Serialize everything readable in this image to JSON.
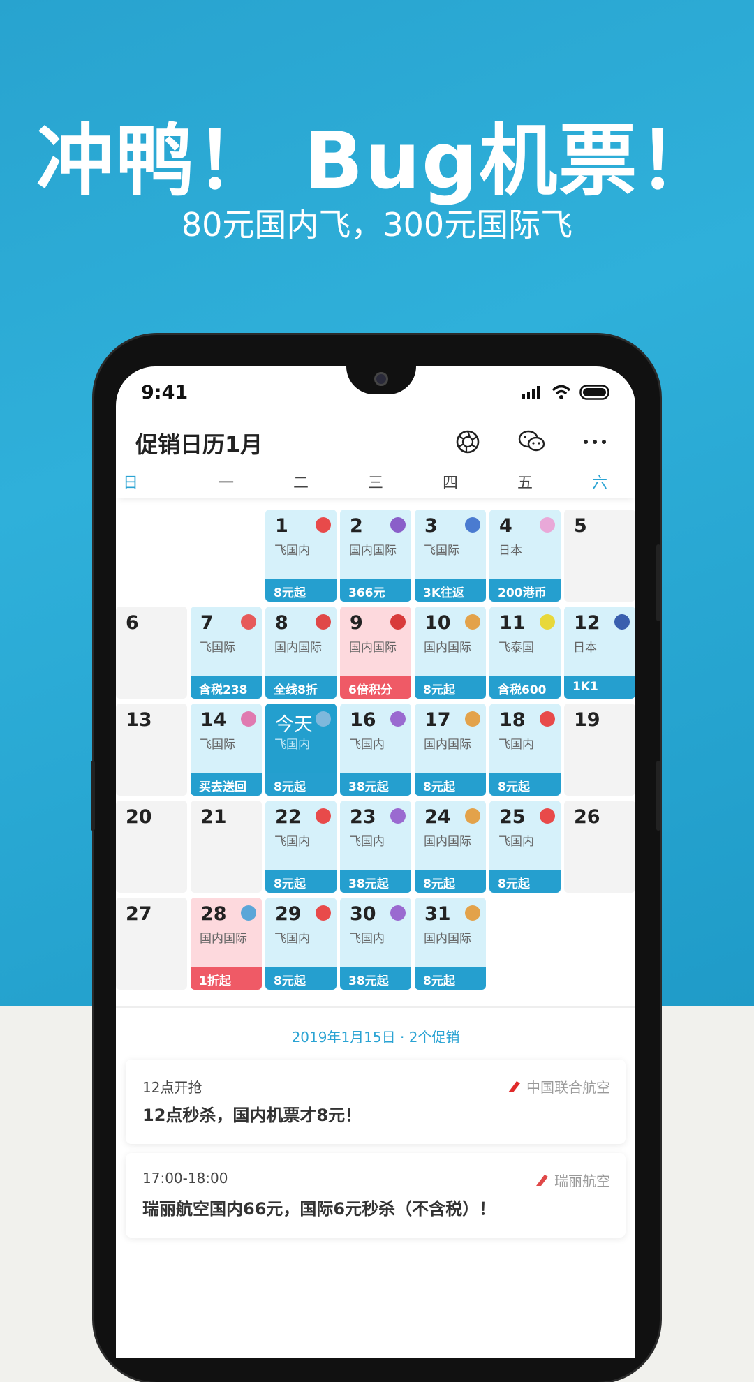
{
  "promo": {
    "headline": "冲鸭！ Bug机票！",
    "subline": "80元国内飞，300元国际飞"
  },
  "status": {
    "time": "9:41"
  },
  "header": {
    "title": "促销日历1月",
    "icons": [
      "shutter-icon",
      "wechat-icon",
      "more-icon"
    ]
  },
  "colors": {
    "accent": "#2aa3d3",
    "promo_bg": "#d6f1fa",
    "pink": "#ef5a66"
  },
  "weekdays": [
    "日",
    "一",
    "二",
    "三",
    "四",
    "五",
    "六"
  ],
  "leading_empty": 2,
  "days": [
    {
      "n": "1",
      "sub": "飞国内",
      "tag": "8元起",
      "type": "promo",
      "logo": "#e84a4a"
    },
    {
      "n": "2",
      "sub": "国内国际",
      "tag": "366元",
      "type": "promo",
      "logo": "#8a5fc9"
    },
    {
      "n": "3",
      "sub": "飞国际",
      "tag": "3K往返",
      "type": "promo",
      "logo": "#4a7bd0"
    },
    {
      "n": "4",
      "sub": "日本",
      "tag": "200港币",
      "type": "promo",
      "logo": "#e9a8d8"
    },
    {
      "n": "5",
      "type": "gray"
    },
    {
      "n": "6",
      "type": "gray"
    },
    {
      "n": "7",
      "sub": "飞国际",
      "tag": "含税238",
      "type": "promo",
      "logo": "#e65a5a"
    },
    {
      "n": "8",
      "sub": "国内国际",
      "tag": "全线8折",
      "type": "promo",
      "logo": "#e04848"
    },
    {
      "n": "9",
      "sub": "国内国际",
      "tag": "6倍积分",
      "type": "pink",
      "logo": "#d83a3a"
    },
    {
      "n": "10",
      "sub": "国内国际",
      "tag": "8元起",
      "type": "promo",
      "logo": "#e3a24a"
    },
    {
      "n": "11",
      "sub": "飞泰国",
      "tag": "含税600",
      "type": "promo",
      "logo": "#e8d83a"
    },
    {
      "n": "12",
      "sub": "日本",
      "tag": "1K1",
      "type": "promo",
      "logo": "#3a5fae"
    },
    {
      "n": "13",
      "type": "gray"
    },
    {
      "n": "14",
      "sub": "飞国际",
      "tag": "买去送回",
      "type": "promo",
      "logo": "#e07ab0"
    },
    {
      "n": "今天",
      "sub": "飞国内",
      "tag": "8元起",
      "type": "today",
      "logo": "#7fb8dc"
    },
    {
      "n": "16",
      "sub": "飞国内",
      "tag": "38元起",
      "type": "promo",
      "logo": "#9a6ad0"
    },
    {
      "n": "17",
      "sub": "国内国际",
      "tag": "8元起",
      "type": "promo",
      "logo": "#e3a24a"
    },
    {
      "n": "18",
      "sub": "飞国内",
      "tag": "8元起",
      "type": "promo",
      "logo": "#e84a4a"
    },
    {
      "n": "19",
      "type": "gray"
    },
    {
      "n": "20",
      "type": "gray"
    },
    {
      "n": "21",
      "type": "gray"
    },
    {
      "n": "22",
      "sub": "飞国内",
      "tag": "8元起",
      "type": "promo",
      "logo": "#e84a4a"
    },
    {
      "n": "23",
      "sub": "飞国内",
      "tag": "38元起",
      "type": "promo",
      "logo": "#9a6ad0"
    },
    {
      "n": "24",
      "sub": "国内国际",
      "tag": "8元起",
      "type": "promo",
      "logo": "#e3a24a"
    },
    {
      "n": "25",
      "sub": "飞国内",
      "tag": "8元起",
      "type": "promo",
      "logo": "#e84a4a"
    },
    {
      "n": "26",
      "type": "gray"
    },
    {
      "n": "27",
      "type": "gray"
    },
    {
      "n": "28",
      "sub": "国内国际",
      "tag": "1折起",
      "type": "pink",
      "logo": "#5aa6d8"
    },
    {
      "n": "29",
      "sub": "飞国内",
      "tag": "8元起",
      "type": "promo",
      "logo": "#e84a4a"
    },
    {
      "n": "30",
      "sub": "飞国内",
      "tag": "38元起",
      "type": "promo",
      "logo": "#9a6ad0"
    },
    {
      "n": "31",
      "sub": "国内国际",
      "tag": "8元起",
      "type": "promo",
      "logo": "#e3a24a"
    }
  ],
  "selected": {
    "date_label": "2019年1月15日 · 2个促销"
  },
  "deals": [
    {
      "time": "12点开抢",
      "text": "12点秒杀，国内机票才8元！",
      "airline": "中国联合航空",
      "logo": "#e02a2a"
    },
    {
      "time": "17:00-18:00",
      "text": "瑞丽航空国内66元，国际6元秒杀（不含税）！",
      "airline": "瑞丽航空",
      "logo": "#e04848"
    }
  ]
}
